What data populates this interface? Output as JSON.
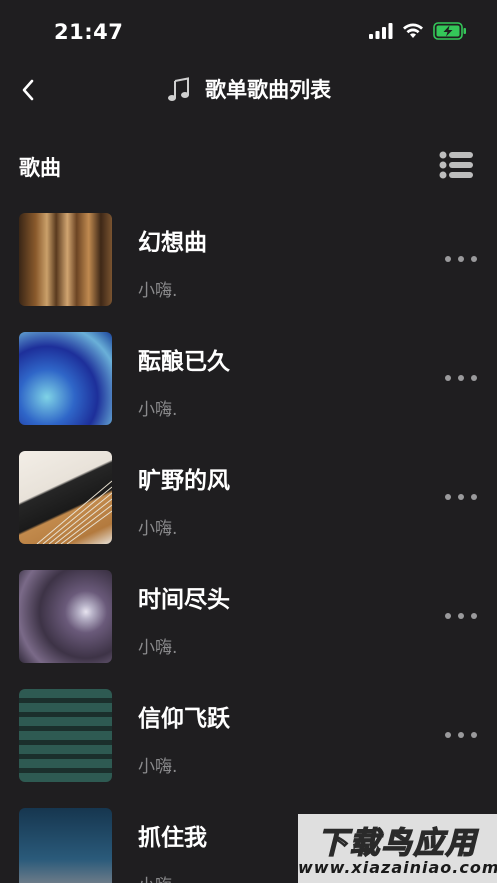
{
  "status_bar": {
    "time": "21:47",
    "icons": [
      "cellular-signal-icon",
      "wifi-icon",
      "battery-charging-icon"
    ],
    "battery_color": "#34c759"
  },
  "nav": {
    "back_icon": "chevron-left-icon",
    "title_icon": "music-note-icon",
    "title": "歌单歌曲列表"
  },
  "section": {
    "title": "歌曲",
    "menu_icon": "list-menu-icon"
  },
  "songs": [
    {
      "title": "幻想曲",
      "artist": "小嗨."
    },
    {
      "title": "酝酿已久",
      "artist": "小嗨."
    },
    {
      "title": "旷野的风",
      "artist": "小嗨."
    },
    {
      "title": "时间尽头",
      "artist": "小嗨."
    },
    {
      "title": "信仰飞跃",
      "artist": "小嗨."
    },
    {
      "title": "抓住我",
      "artist": "小嗨."
    }
  ],
  "watermark": {
    "main": "下载鸟应用",
    "sub": "www.xiazainiao.com"
  },
  "colors": {
    "background": "#1f1e20",
    "text_primary": "#ffffff",
    "text_secondary": "#8a8a8c"
  }
}
